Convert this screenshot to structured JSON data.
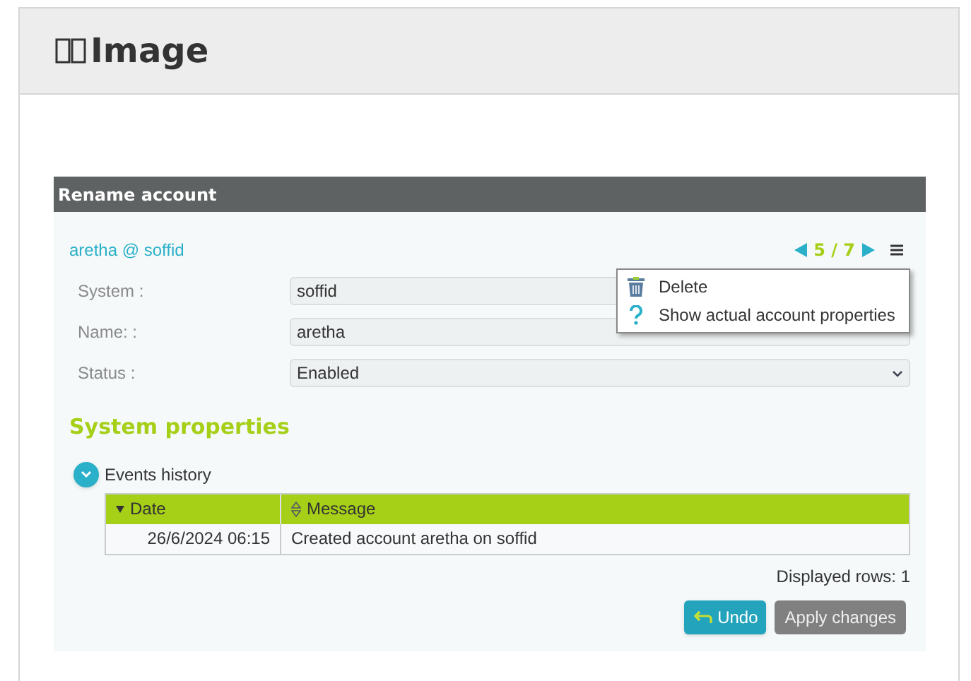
{
  "page": {
    "title": "Image"
  },
  "dialog": {
    "title": "Rename account",
    "account": "aretha @ soffid",
    "pager": "5 / 7",
    "fields": [
      {
        "kind": "text",
        "label": "System :",
        "value": "soffid"
      },
      {
        "kind": "text",
        "label": "Name: :",
        "value": "aretha"
      },
      {
        "kind": "select",
        "label": "Status :",
        "value": "Enabled"
      }
    ],
    "section_title": "System properties",
    "events": {
      "title": "Events history",
      "expanded": true,
      "columns": [
        {
          "label": "Date",
          "sorted": true
        },
        {
          "label": "Message",
          "sorted": false
        }
      ],
      "rows": [
        [
          "26/6/2024 06:15",
          "Created account aretha on soffid"
        ]
      ],
      "footer": "Displayed rows: 1"
    },
    "buttons": [
      {
        "kind": "primary",
        "label": "Undo"
      },
      {
        "kind": "secondary",
        "label": "Apply changes"
      }
    ]
  },
  "menu": [
    {
      "kind": "delete",
      "label": "Delete"
    },
    {
      "kind": "help",
      "label": "Show actual account properties"
    }
  ]
}
